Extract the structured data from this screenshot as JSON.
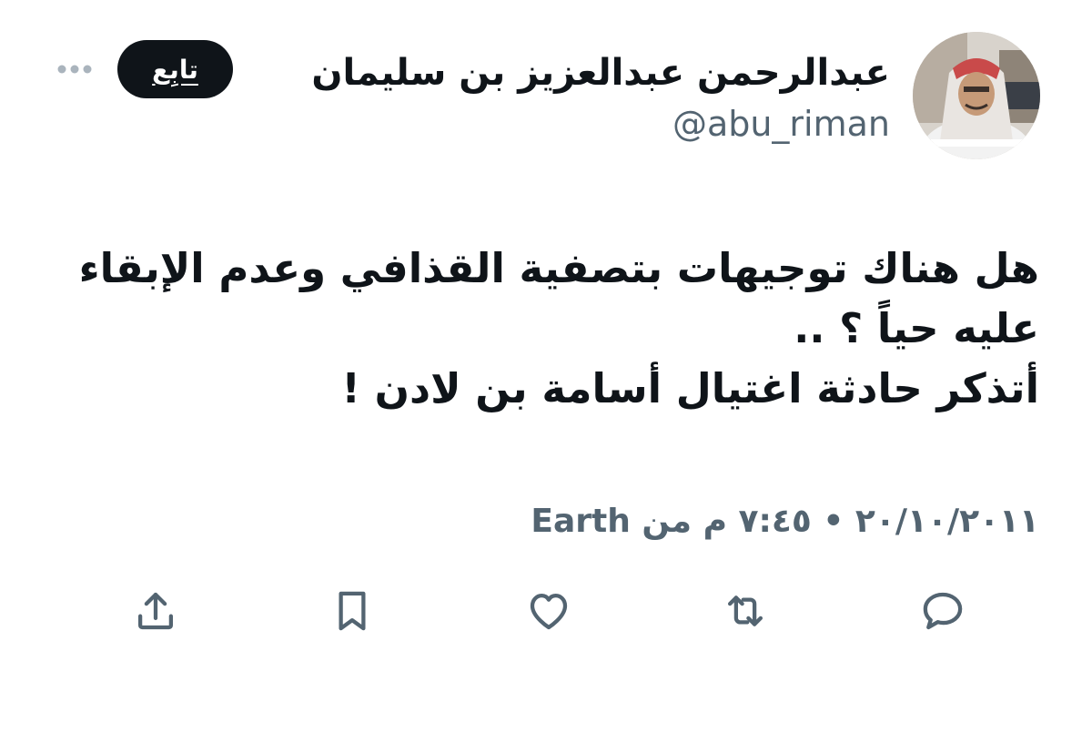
{
  "header": {
    "display_name": "عبدالرحمن عبدالعزيز بن سليمان",
    "handle": "@abu_riman",
    "follow_label": "تابِع",
    "more_icon": "more-horizontal-icon"
  },
  "tweet": {
    "lines": [
      "هل هناك توجيهات بتصفية القذافي وعدم الإبقاء",
      "عليه حياً ؟ ..",
      "أتذكر حادثة اغتيال أسامة بن لادن !"
    ],
    "meta": "٢٠/١٠/٢٠١١ • ٧:٤٥ م من Earth"
  },
  "actions": [
    {
      "name": "reply",
      "icon": "comment-icon"
    },
    {
      "name": "retweet",
      "icon": "retweet-icon"
    },
    {
      "name": "like",
      "icon": "heart-icon"
    },
    {
      "name": "bookmark",
      "icon": "bookmark-icon"
    },
    {
      "name": "share",
      "icon": "share-icon"
    }
  ],
  "colors": {
    "text": "#0f1419",
    "secondary": "#536471",
    "follow_bg": "#0f1419",
    "background": "#ffffff"
  }
}
